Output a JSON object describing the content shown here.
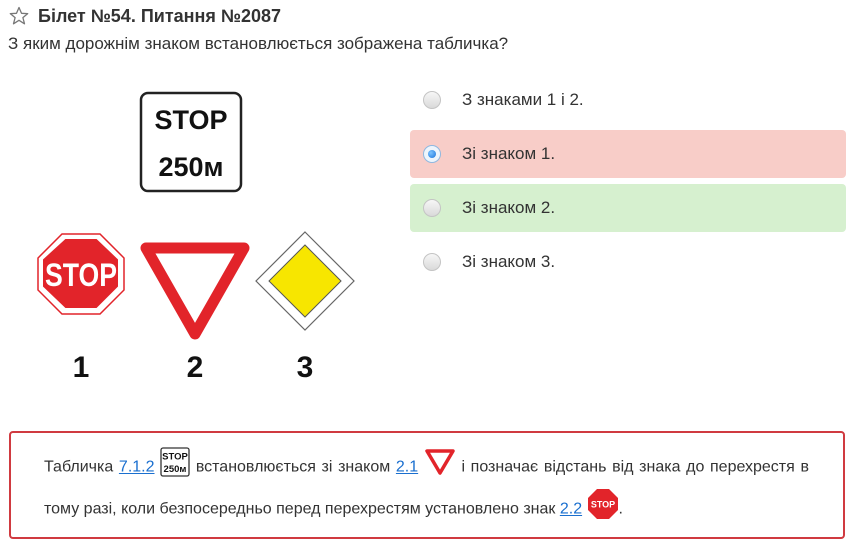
{
  "header": {
    "title": "Білет №54. Питання №2087",
    "question": "З яким дорожнім знаком встановлюється зображена табличка?"
  },
  "image": {
    "plate_line1": "STOP",
    "plate_line2": "250м",
    "sign1_text": "STOP",
    "label1": "1",
    "label2": "2",
    "label3": "3"
  },
  "answers": [
    {
      "label": "З знаками 1 і 2.",
      "state": "none",
      "checked": false
    },
    {
      "label": "Зі знаком 1.",
      "state": "wrong",
      "checked": true
    },
    {
      "label": "Зі знаком 2.",
      "state": "correct",
      "checked": false
    },
    {
      "label": "Зі знаком 3.",
      "state": "none",
      "checked": false
    }
  ],
  "explanation": {
    "t1": "Табличка",
    "link1": "7.1.2",
    "icon1_line1": "STOP",
    "icon1_line2": "250м",
    "t2": "встановлюється зі знаком",
    "link2": "2.1",
    "t3": "і позначає відстань від знака до перехрестя в тому разі, коли безпосередньо перед перехрестям установлено знак",
    "link3": "2.2",
    "icon3_text": "STOP",
    "t4": "."
  },
  "colors": {
    "wrong_bg": "#f8cdc8",
    "correct_bg": "#d6f0cf",
    "explain_border": "#d03a40",
    "link": "#1a6fcf",
    "stop_red": "#e2242a",
    "main_road_yellow": "#f7e600"
  },
  "icons": [
    "star-outline-icon",
    "radio-icon",
    "yield-sign-icon",
    "stop-sign-icon",
    "main-road-sign-icon"
  ]
}
